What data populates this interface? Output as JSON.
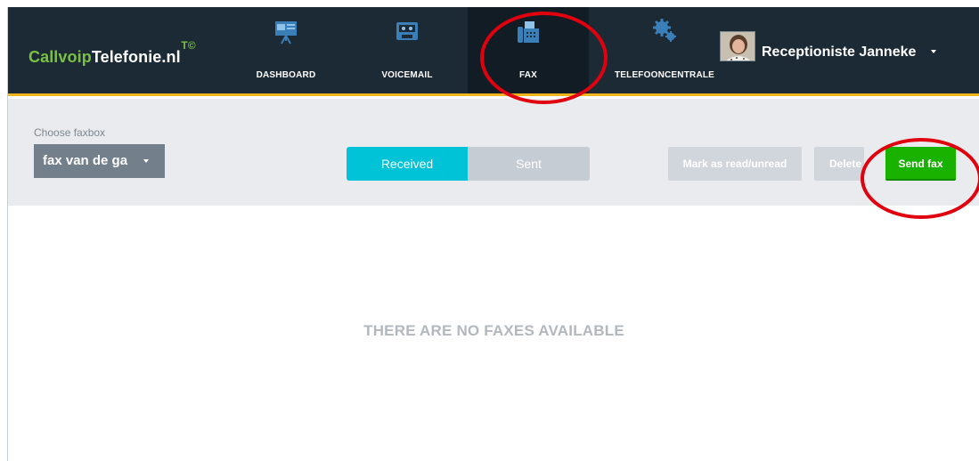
{
  "brand": {
    "logo_part1": "Callvoip",
    "logo_part2": "Telefonie.nl",
    "logo_sup": "T©"
  },
  "nav": {
    "items": [
      {
        "label": "DASHBOARD",
        "icon": "presentation-board-icon"
      },
      {
        "label": "VOICEMAIL",
        "icon": "cassette-tape-icon"
      },
      {
        "label": "FAX",
        "icon": "fax-machine-icon",
        "active": true
      },
      {
        "label": "TELEFOONCENTRALE",
        "icon": "gears-icon"
      }
    ]
  },
  "user": {
    "name": "Receptioniste Janneke"
  },
  "toolbar": {
    "choose_label": "Choose faxbox",
    "faxbox_value": "fax van de ga",
    "tabs": [
      {
        "label": "Received",
        "active": true
      },
      {
        "label": "Sent",
        "active": false
      }
    ],
    "mark_label": "Mark as read/unread",
    "delete_label": "Delete",
    "send_label": "Send fax"
  },
  "content": {
    "empty_message": "THERE ARE NO FAXES AVAILABLE"
  },
  "colors": {
    "topbar": "#1c2a36",
    "accent_line": "#f0b41c",
    "received_tab": "#00c3d7",
    "send_button": "#19b200",
    "annotation": "#e0000e"
  }
}
